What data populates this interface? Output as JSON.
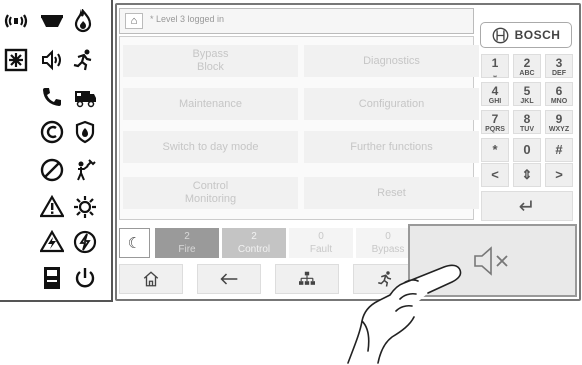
{
  "left_icons": [
    {
      "name": "alarm-device-icon",
      "col": 0,
      "row": 0
    },
    {
      "name": "sounder-base-icon",
      "col": 1,
      "row": 0
    },
    {
      "name": "fire-flame-icon",
      "col": 2,
      "row": 0
    },
    {
      "name": "emergency-box-icon",
      "col": 0,
      "row": 1
    },
    {
      "name": "speaker-icon",
      "col": 1,
      "row": 1
    },
    {
      "name": "running-person-icon",
      "col": 2,
      "row": 1
    },
    {
      "name": "phone-icon",
      "col": 1,
      "row": 2
    },
    {
      "name": "fire-truck-icon",
      "col": 2,
      "row": 2
    },
    {
      "name": "copyright-c-icon",
      "col": 1,
      "row": 3
    },
    {
      "name": "extinguishing-icon",
      "col": 2,
      "row": 3
    },
    {
      "name": "disabled-icon",
      "col": 1,
      "row": 4
    },
    {
      "name": "person-maintenance-icon",
      "col": 2,
      "row": 4
    },
    {
      "name": "warning-triangle-icon",
      "col": 1,
      "row": 5
    },
    {
      "name": "sun-icon",
      "col": 2,
      "row": 5
    },
    {
      "name": "fault-triangle-icon",
      "col": 1,
      "row": 6
    },
    {
      "name": "no-lightning-icon",
      "col": 2,
      "row": 6
    },
    {
      "name": "printer-icon",
      "col": 1,
      "row": 7
    },
    {
      "name": "power-icon",
      "col": 2,
      "row": 7
    }
  ],
  "header": {
    "home_icon": "home-icon",
    "status_text": "* Level 3 logged in"
  },
  "menu": {
    "bypass_block": "Bypass\nBlock",
    "diagnostics": "Diagnostics",
    "maintenance": "Maintenance",
    "configuration": "Configuration",
    "switch_day_mode": "Switch to day mode",
    "further_functions": "Further functions",
    "control_monitoring": "Control\nMonitoring",
    "reset": "Reset"
  },
  "brand": "BOSCH",
  "keypad": {
    "keys": [
      {
        "d": "1",
        "l": "⎵"
      },
      {
        "d": "2",
        "l": "ABC"
      },
      {
        "d": "3",
        "l": "DEF"
      },
      {
        "d": "4",
        "l": "GHI"
      },
      {
        "d": "5",
        "l": "JKL"
      },
      {
        "d": "6",
        "l": "MNO"
      },
      {
        "d": "7",
        "l": "PQRS"
      },
      {
        "d": "8",
        "l": "TUV"
      },
      {
        "d": "9",
        "l": "WXYZ"
      },
      {
        "d": "*",
        "l": ""
      },
      {
        "d": "0",
        "l": ""
      },
      {
        "d": "#",
        "l": ""
      }
    ],
    "arrows": [
      "<",
      "⇕",
      ">"
    ],
    "enter": "↵"
  },
  "status": {
    "fire": {
      "count": "2",
      "label": "Fire"
    },
    "control": {
      "count": "2",
      "label": "Control"
    },
    "fault": {
      "count": "0",
      "label": "Fault"
    },
    "bypass": {
      "count": "0",
      "label": "Bypass"
    }
  },
  "nav": {
    "home": "home-icon",
    "back": "back-arrow-icon",
    "structure": "network-structure-icon",
    "evacuation": "evacuation-icon"
  },
  "silence_button": {
    "icon": "speaker-mute-icon"
  },
  "colors": {
    "fire_bg": "#9a9a9a",
    "control_bg": "#c4c4c4",
    "disabled_text": "#c6c6c6",
    "brand_text": "#444444"
  }
}
